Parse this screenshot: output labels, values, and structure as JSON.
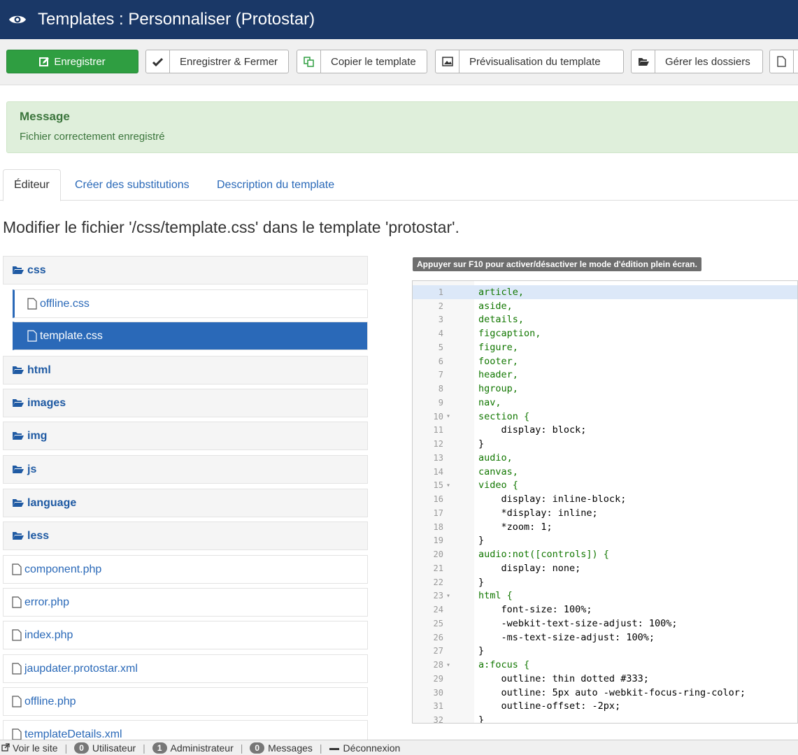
{
  "header": {
    "title": "Templates : Personnaliser (Protostar)"
  },
  "toolbar": {
    "save": "Enregistrer",
    "save_close": "Enregistrer & Fermer",
    "copy": "Copier le template",
    "preview": "Prévisualisation du template",
    "folders": "Gérer les dossiers"
  },
  "message": {
    "heading": "Message",
    "text": "Fichier correctement enregistré"
  },
  "tabs": [
    "Éditeur",
    "Créer des substitutions",
    "Description du template"
  ],
  "page_title": "Modifier le fichier '/css/template.css' dans le template 'protostar'.",
  "tree": {
    "folder_css": "css",
    "file_offline_css": "offline.css",
    "file_template_css": "template.css",
    "folder_html": "html",
    "folder_images": "images",
    "folder_img": "img",
    "folder_js": "js",
    "folder_language": "language",
    "folder_less": "less",
    "file_component": "component.php",
    "file_error": "error.php",
    "file_index": "index.php",
    "file_jaupdater": "jaupdater.protostar.xml",
    "file_offline": "offline.php",
    "file_templatedetails": "templateDetails.xml"
  },
  "editor": {
    "hint": "Appuyer sur F10 pour activer/désactiver le mode d'édition plein écran.",
    "lines": [
      "article,",
      "aside,",
      "details,",
      "figcaption,",
      "figure,",
      "footer,",
      "header,",
      "hgroup,",
      "nav,",
      "section {",
      "    display: block;",
      "}",
      "audio,",
      "canvas,",
      "video {",
      "    display: inline-block;",
      "    *display: inline;",
      "    *zoom: 1;",
      "}",
      "audio:not([controls]) {",
      "    display: none;",
      "}",
      "html {",
      "    font-size: 100%;",
      "    -webkit-text-size-adjust: 100%;",
      "    -ms-text-size-adjust: 100%;",
      "}",
      "a:focus {",
      "    outline: thin dotted #333;",
      "    outline: 5px auto -webkit-focus-ring-color;",
      "    outline-offset: -2px;",
      "}"
    ],
    "fold_lines": [
      10,
      15,
      23,
      28
    ]
  },
  "status": {
    "view_site": "Voir le site",
    "users_count": "0",
    "users_label": "Utilisateur",
    "admins_count": "1",
    "admins_label": "Administrateur",
    "messages_count": "0",
    "messages_label": "Messages",
    "logout": "Déconnexion"
  }
}
